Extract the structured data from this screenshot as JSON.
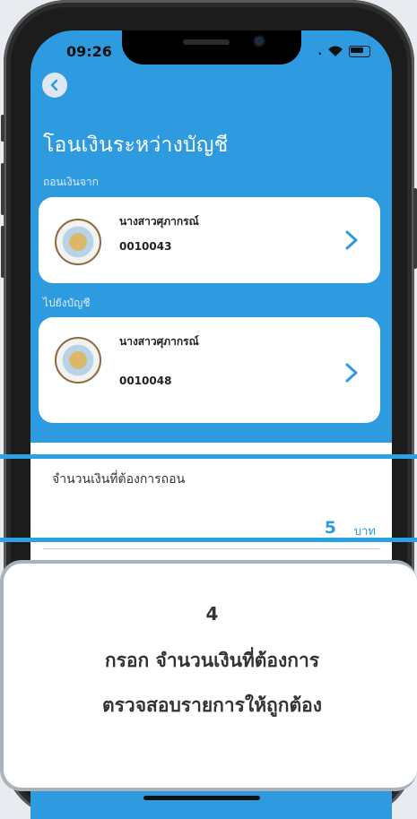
{
  "status_bar": {
    "time": "09:26"
  },
  "page": {
    "title": "โอนเงินระหว่างบัญชี"
  },
  "from_section": {
    "label": "ถอนเงินจาก",
    "account_name": "นางสาวศุภากรณ์",
    "account_number": "0010043"
  },
  "to_section": {
    "label": "ไปยังบัญชี",
    "account_name": "นางสาวศุภากรณ์",
    "account_number": "0010048"
  },
  "amount": {
    "label": "จำนวนเงินที่ต้องการถอน",
    "value": "5",
    "unit": "บาท"
  },
  "callout": {
    "step": "4",
    "line1": "กรอก จำนวนเงินที่ต้องการ",
    "line2": "ตรวจสอบรายการให้ถูกต้อง"
  },
  "colors": {
    "primary": "#2e9ae0",
    "highlight": "#2aa2e6"
  }
}
